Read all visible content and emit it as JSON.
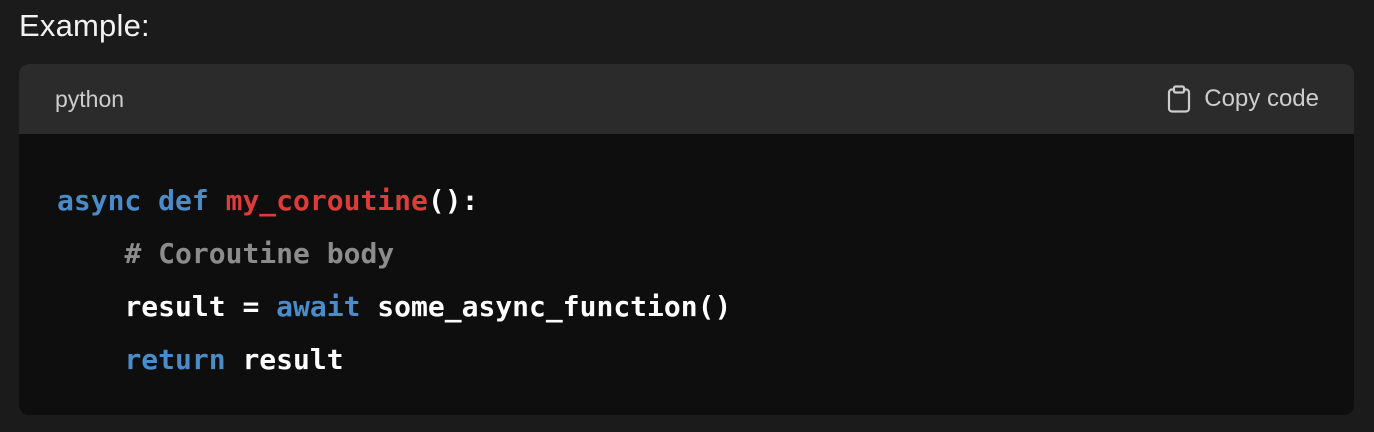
{
  "heading": "Example:",
  "code_block": {
    "language": "python",
    "copy_label": "Copy code",
    "copy_icon": "clipboard-icon",
    "colors": {
      "keyword": "#4a8cc9",
      "function": "#e03a3a",
      "comment": "#8c8c8c",
      "plain": "#ffffff"
    },
    "lines": [
      {
        "tokens": [
          {
            "t": "async",
            "c": "kw"
          },
          {
            "t": " ",
            "c": "pl"
          },
          {
            "t": "def",
            "c": "kw"
          },
          {
            "t": " ",
            "c": "pl"
          },
          {
            "t": "my_coroutine",
            "c": "fn"
          },
          {
            "t": "():",
            "c": "pl"
          }
        ]
      },
      {
        "tokens": [
          {
            "t": "    ",
            "c": "pl"
          },
          {
            "t": "# Coroutine body",
            "c": "cm"
          }
        ]
      },
      {
        "tokens": [
          {
            "t": "    ",
            "c": "pl"
          },
          {
            "t": "result = ",
            "c": "pl"
          },
          {
            "t": "await",
            "c": "kw"
          },
          {
            "t": " some_async_function()",
            "c": "pl"
          }
        ]
      },
      {
        "tokens": [
          {
            "t": "    ",
            "c": "pl"
          },
          {
            "t": "return",
            "c": "kw"
          },
          {
            "t": " result",
            "c": "pl"
          }
        ]
      }
    ]
  }
}
